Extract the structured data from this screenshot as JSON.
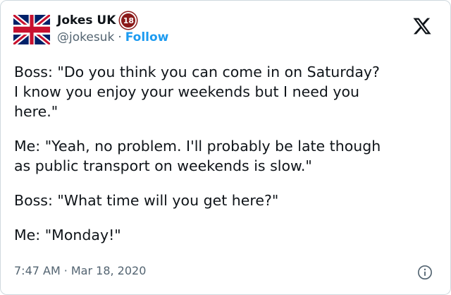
{
  "author": {
    "name": "Jokes UK",
    "badge": "18",
    "handle": "@jokesuk",
    "separator": "·",
    "follow_label": "Follow",
    "avatar_flag": "uk-flag"
  },
  "tweet": {
    "paragraphs": [
      "Boss: \"Do you think you can come in on Saturday?\nI know you enjoy your weekends but I need you\nhere.\"",
      "Me: \"Yeah, no problem. I'll probably be late though\nas public transport on weekends is slow.\"",
      "Boss: \"What time will you get here?\"",
      "Me: \"Monday!\""
    ]
  },
  "meta": {
    "time": "7:47 AM",
    "separator": "·",
    "date": "Mar 18, 2020"
  },
  "colors": {
    "text": "#0f1419",
    "secondary": "#536471",
    "link": "#1d9bf0",
    "border": "#cfd9de"
  },
  "icons": {
    "platform": "x-logo-icon",
    "info": "info-icon"
  }
}
